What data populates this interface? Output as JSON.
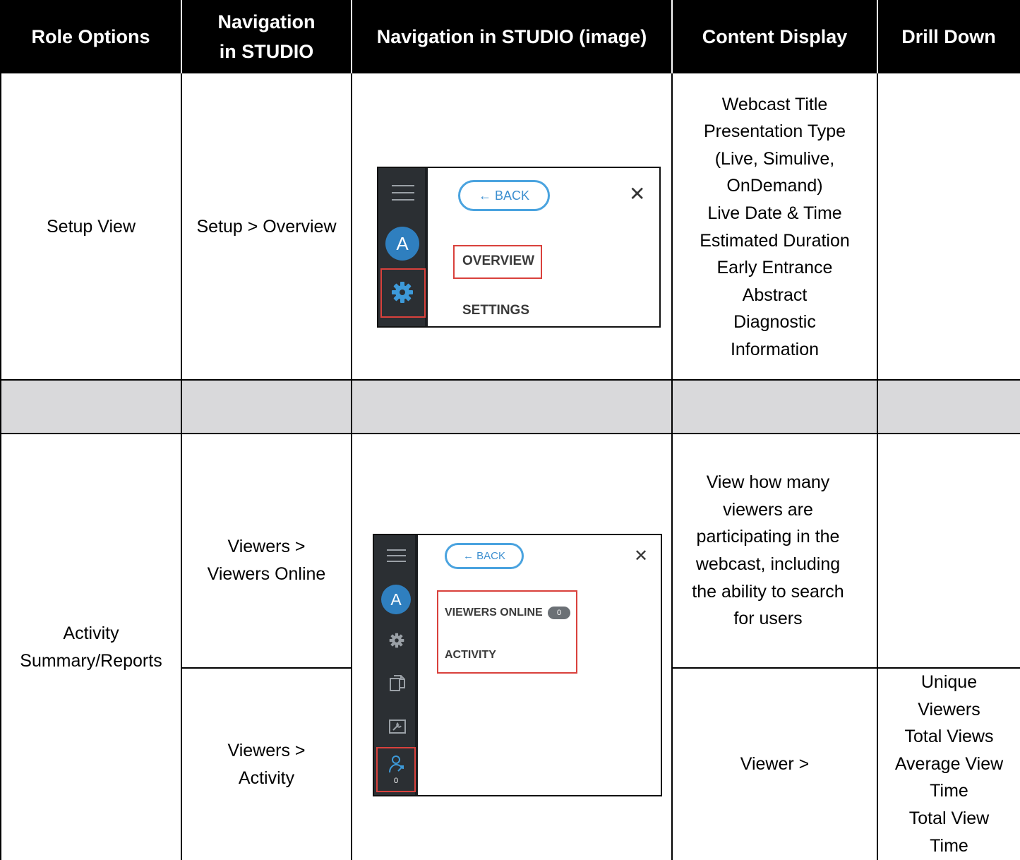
{
  "table": {
    "headers": [
      "Role Options",
      "Navigation in STUDIO",
      "Navigation in STUDIO (image)",
      "Content Display",
      "Drill Down"
    ],
    "row1": {
      "role": "Setup View",
      "navigation": "Setup > Overview",
      "content": [
        "Webcast Title",
        "Presentation Type",
        "(Live, Simulive,",
        "OnDemand)",
        "Live Date & Time",
        "Estimated Duration",
        "Early Entrance",
        "Abstract",
        "Diagnostic",
        "Information"
      ],
      "drill": ""
    },
    "row3": {
      "role_line1": "Activity",
      "role_line2": "Summary/Reports",
      "navigation_a_line1": "Viewers >",
      "navigation_a_line2": "Viewers Online",
      "navigation_b_line1": "Viewers >",
      "navigation_b_line2": "Activity",
      "content_a": [
        "View how many",
        "viewers are",
        "participating in the",
        "webcast, including",
        "the ability to search",
        "for users"
      ],
      "content_b": "Viewer >",
      "drill_b": [
        "Unique",
        "Viewers",
        "Total Views",
        "Average View",
        "Time",
        "Total View",
        "Time"
      ]
    }
  },
  "mock_setup": {
    "avatar_letter": "A",
    "back_label": "← BACK",
    "close_glyph": "✕",
    "overview_label": "OVERVIEW",
    "settings_label": "SETTINGS"
  },
  "mock_viewers": {
    "avatar_letter": "A",
    "back_label": "← BACK",
    "close_glyph": "✕",
    "viewers_online_label": "VIEWERS ONLINE",
    "viewers_online_count": "0",
    "activity_label": "ACTIVITY",
    "viewer_icon_count": "0"
  },
  "colors": {
    "header_bg": "#000000",
    "spacer_row_bg": "#d9d9db",
    "rail_bg": "#2b2f33",
    "accent_blue": "#2f7fbf",
    "highlight_red": "#d9413c"
  }
}
